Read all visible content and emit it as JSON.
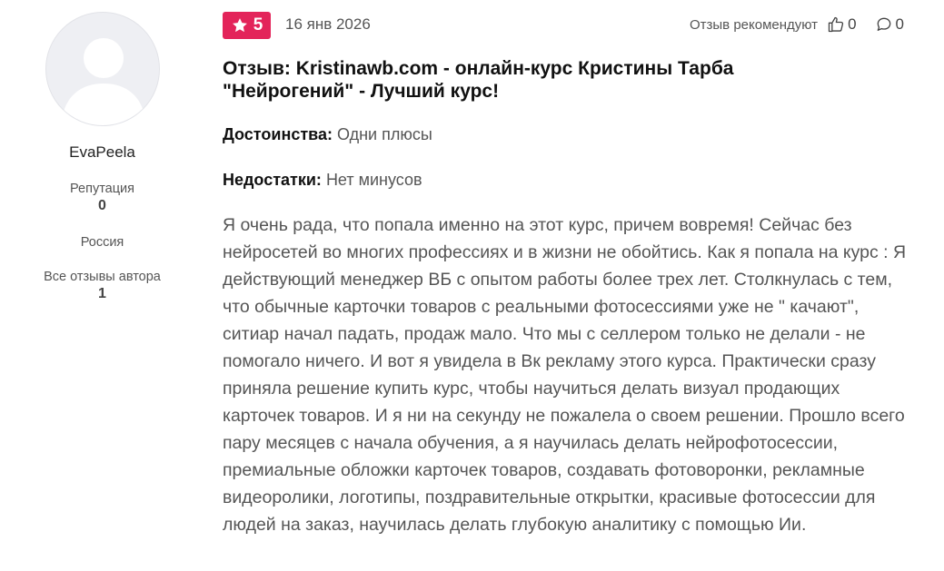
{
  "author": {
    "name": "EvaPeela",
    "reputation_label": "Репутация",
    "reputation_value": "0",
    "country": "Россия",
    "all_reviews_label": "Все отзывы автора",
    "all_reviews_value": "1"
  },
  "review": {
    "rating": "5",
    "date": "16 янв 2026",
    "recommend_label": "Отзыв рекомендуют",
    "likes": "0",
    "comments": "0",
    "title": "Отзыв: Kristinawb.com - онлайн-курс Кристины Тарба \"Нейрогений\" - Лучший курс!",
    "pros_label": "Достоинства:",
    "pros_value": "Одни плюсы",
    "cons_label": "Недостатки:",
    "cons_value": "Нет минусов",
    "text": "Я очень рада, что попала именно на этот курс, причем вовремя! Сейчас без нейросетей во многих профессиях и в жизни не обойтись. Как я попала на курс : Я действующий менеджер ВБ с опытом работы более трех лет. Столкнулась с тем, что обычные карточки товаров с реальными фотосессиями уже не \" качают\", ситиар начал падать, продаж мало. Что мы с селлером только не делали - не помогало ничего. И вот я увидела в Вк рекламу этого курса. Практически сразу приняла решение купить курс, чтобы научиться делать визуал продающих карточек товаров. И я ни на секунду не пожалела о своем решении. Прошло всего пару месяцев с начала обучения, а я научилась делать нейрофотосессии, премиальные обложки карточек товаров, создавать фотоворонки, рекламные видеоролики, логотипы, поздравительные открытки, красивые фотосессии для людей на заказ, научилась делать глубокую аналитику с помощью Ии."
  },
  "colors": {
    "rating_badge": "#e3245a",
    "text_muted": "#555555",
    "avatar_bg": "#eeeff3"
  },
  "icons": {
    "rating": "star-icon",
    "like": "thumb-up-icon",
    "comment": "comment-bubble-icon",
    "avatar": "user-silhouette-icon"
  }
}
